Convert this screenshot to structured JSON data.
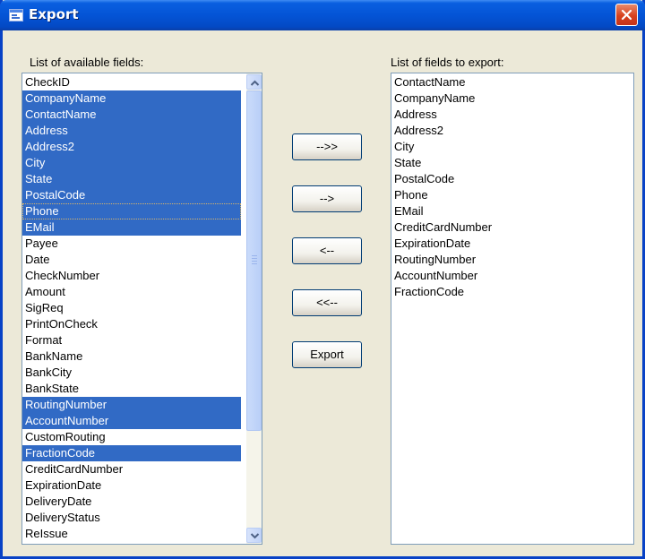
{
  "window": {
    "title": "Export"
  },
  "available": {
    "label": "List of available fields:",
    "items": [
      {
        "text": "CheckID",
        "selected": false
      },
      {
        "text": "CompanyName",
        "selected": true
      },
      {
        "text": "ContactName",
        "selected": true
      },
      {
        "text": "Address",
        "selected": true
      },
      {
        "text": "Address2",
        "selected": true
      },
      {
        "text": "City",
        "selected": true
      },
      {
        "text": "State",
        "selected": true
      },
      {
        "text": "PostalCode",
        "selected": true
      },
      {
        "text": "Phone",
        "selected": true,
        "focused": true
      },
      {
        "text": "EMail",
        "selected": true
      },
      {
        "text": "Payee",
        "selected": false
      },
      {
        "text": "Date",
        "selected": false
      },
      {
        "text": "CheckNumber",
        "selected": false
      },
      {
        "text": "Amount",
        "selected": false
      },
      {
        "text": "SigReq",
        "selected": false
      },
      {
        "text": "PrintOnCheck",
        "selected": false
      },
      {
        "text": "Format",
        "selected": false
      },
      {
        "text": "BankName",
        "selected": false
      },
      {
        "text": "BankCity",
        "selected": false
      },
      {
        "text": "BankState",
        "selected": false
      },
      {
        "text": "RoutingNumber",
        "selected": true
      },
      {
        "text": "AccountNumber",
        "selected": true
      },
      {
        "text": "CustomRouting",
        "selected": false
      },
      {
        "text": "FractionCode",
        "selected": true
      },
      {
        "text": "CreditCardNumber",
        "selected": false
      },
      {
        "text": "ExpirationDate",
        "selected": false
      },
      {
        "text": "DeliveryDate",
        "selected": false
      },
      {
        "text": "DeliveryStatus",
        "selected": false
      },
      {
        "text": "ReIssue",
        "selected": false
      }
    ]
  },
  "export_list": {
    "label": "List of fields to export:",
    "items": [
      "ContactName",
      "CompanyName",
      "Address",
      "Address2",
      "City",
      "State",
      "PostalCode",
      "Phone",
      "EMail",
      "CreditCardNumber",
      "ExpirationDate",
      "RoutingNumber",
      "AccountNumber",
      "FractionCode"
    ]
  },
  "buttons": {
    "add_all": "-->>",
    "add": "-->",
    "remove": "<--",
    "remove_all": "<<--",
    "export": "Export"
  },
  "colors": {
    "selection": "#316ac5",
    "titlebar": "#0454d6",
    "dialog_bg": "#ece9d8"
  }
}
